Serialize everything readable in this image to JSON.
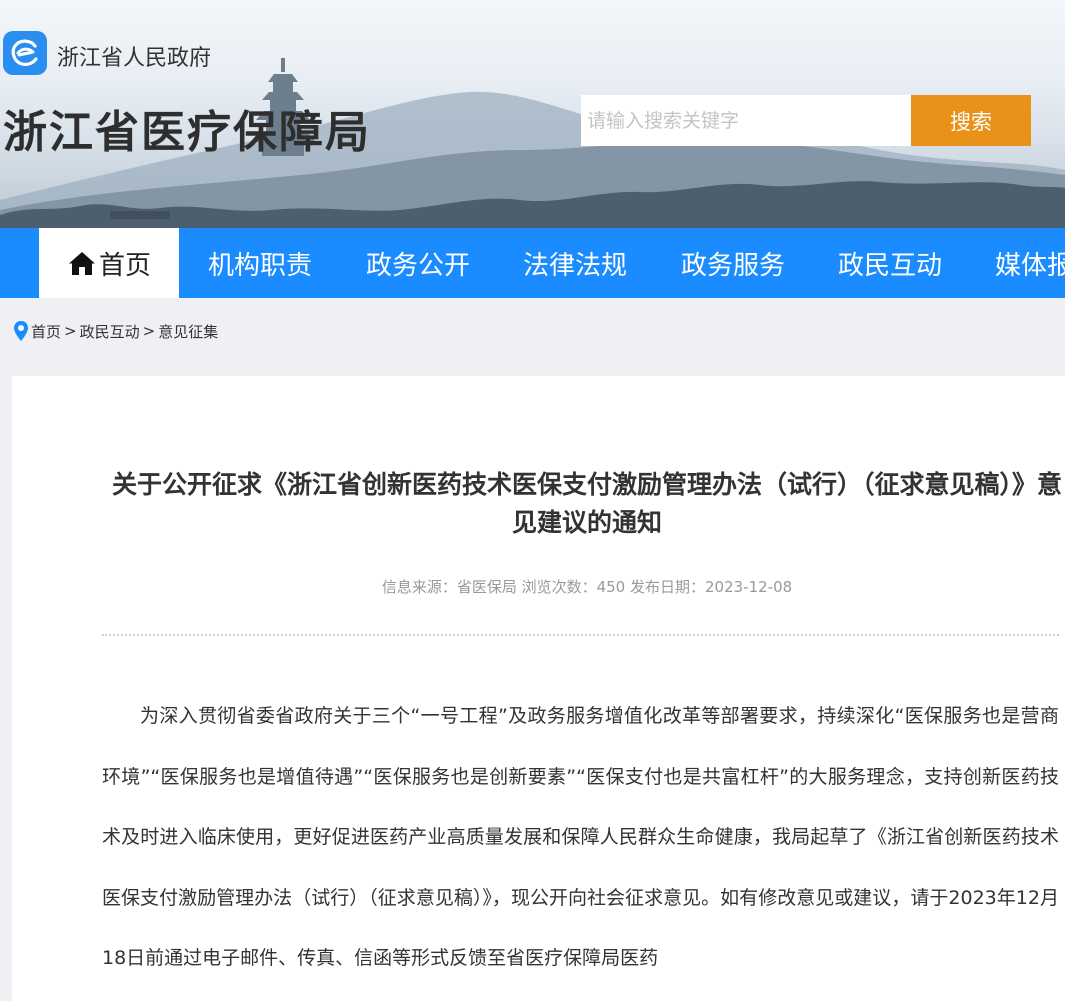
{
  "header": {
    "gov_name": "浙江省人民政府",
    "site_title": "浙江省医疗保障局",
    "search_placeholder": "请输入搜索关键字",
    "search_button": "搜索"
  },
  "nav": {
    "items": [
      {
        "label": "首页",
        "active": true
      },
      {
        "label": "机构职责"
      },
      {
        "label": "政务公开"
      },
      {
        "label": "法律法规"
      },
      {
        "label": "政务服务"
      },
      {
        "label": "政民互动"
      },
      {
        "label": "媒体报"
      }
    ]
  },
  "breadcrumb": {
    "items": [
      "首页",
      "政民互动",
      "意见征集"
    ],
    "separator": ">"
  },
  "article": {
    "title": "关于公开征求《浙江省创新医药技术医保支付激励管理办法（试行）（征求意见稿）》意见建议的通知",
    "meta": "信息来源：省医保局 浏览次数：450 发布日期：2023-12-08",
    "body": "为深入贯彻省委省政府关于三个“一号工程”及政务服务增值化改革等部署要求，持续深化“医保服务也是营商环境”“医保服务也是增值待遇”“医保服务也是创新要素”“医保支付也是共富杠杆”的大服务理念，支持创新医药技术及时进入临床使用，更好促进医药产业高质量发展和保障人民群众生命健康，我局起草了《浙江省创新医药技术医保支付激励管理办法（试行）（征求意见稿）》，现公开向社会征求意见。如有修改意见或建议，请于2023年12月18日前通过电子邮件、传真、信函等形式反馈至省医疗保障局医药"
  },
  "colors": {
    "nav_bg": "#1a8cff",
    "search_button": "#e8921a",
    "logo": "#2a8df0"
  }
}
